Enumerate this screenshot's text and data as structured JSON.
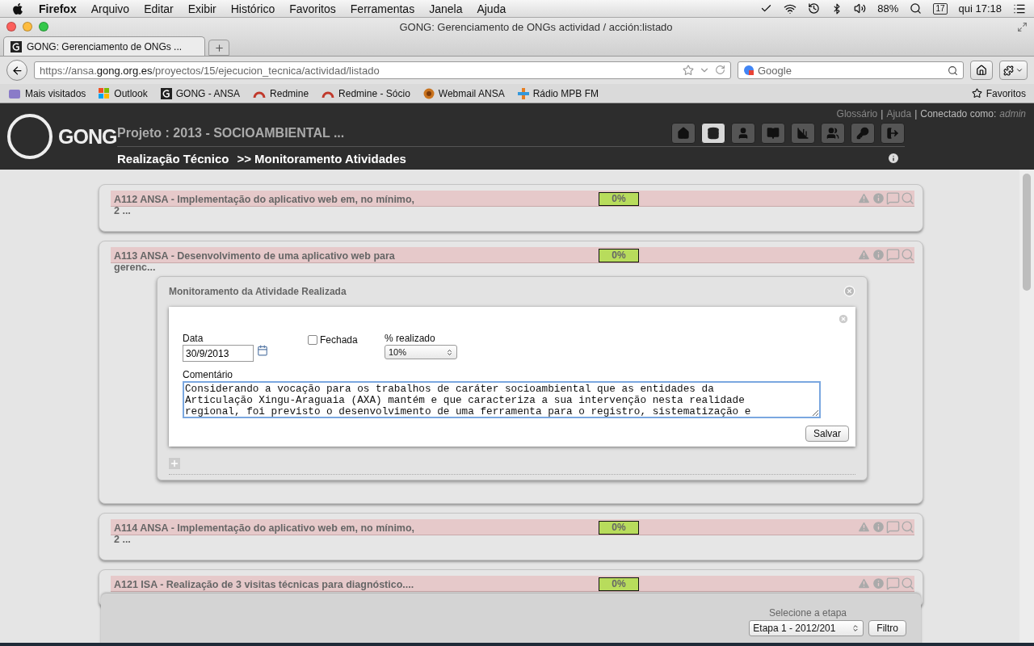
{
  "browser": {
    "menubar": {
      "app": "Firefox",
      "menus": [
        "Arquivo",
        "Editar",
        "Exibir",
        "Histórico",
        "Favoritos",
        "Ferramentas",
        "Janela",
        "Ajuda"
      ],
      "battery": "88%",
      "date_badge": "17",
      "clock": "qui 17:18"
    },
    "window_title": "GONG: Gerenciamento de ONGs actividad / acción:listado",
    "tabs": [
      {
        "title": "GONG: Gerenciamento de ONGs ...",
        "selected": true
      }
    ],
    "url": "https://ansa.**gong.org.es**/proyectos/15/ejecucion_tecnica/actividad/listado",
    "search": {
      "placeholder": "Google"
    },
    "bookmarks": [
      {
        "label": "Mais visitados",
        "kind": "folder"
      },
      {
        "label": "Outlook",
        "kind": "tiles"
      },
      {
        "label": "GONG - ANSA",
        "kind": "letter"
      },
      {
        "label": "Redmine",
        "kind": "arc"
      },
      {
        "label": "Redmine - Sócio",
        "kind": "arc"
      },
      {
        "label": "Webmail ANSA",
        "kind": "globe"
      },
      {
        "label": "Rádio MPB FM",
        "kind": "cross"
      }
    ],
    "favorites": "Favoritos"
  },
  "header": {
    "logo": "GONG",
    "project": "Projeto : 2013 - SOCIOAMBIENTAL ...",
    "links": [
      "Glossário",
      "Ajuda"
    ],
    "separator": "|",
    "connected_label": "Conectado como:",
    "user": "admin",
    "breadcrumb": [
      "Realização Técnico",
      ">> Monitoramento Atividades"
    ],
    "nav": [
      {
        "kind": "home",
        "selected": false
      },
      {
        "kind": "database",
        "selected": true
      },
      {
        "kind": "user",
        "selected": false
      },
      {
        "kind": "book",
        "selected": false
      },
      {
        "kind": "chart",
        "selected": false
      },
      {
        "kind": "users",
        "selected": false
      },
      {
        "kind": "key",
        "selected": false
      },
      {
        "kind": "exit",
        "selected": false
      }
    ]
  },
  "activities": [
    {
      "title": "A112 ANSA - Implementação do aplicativo web em, no mínimo, 2 ...",
      "progress": "0%",
      "expanded": false
    },
    {
      "title": "A113 ANSA - Desenvolvimento de uma aplicativo web para gerenc...",
      "progress": "0%",
      "expanded": true
    },
    {
      "title": "A114 ANSA - Implementação do aplicativo web em, no mínimo, 2 ...",
      "progress": "0%",
      "expanded": false
    },
    {
      "title": "A121 ISA - Realização de 3 visitas técnicas para diagnóstico....",
      "progress": "0%",
      "expanded": false
    }
  ],
  "monitor": {
    "title": "Monitoramento da Atividade Realizada",
    "date_label": "Data",
    "date_value": "30/9/2013",
    "closed": {
      "label": "Fechada",
      "checked": false
    },
    "percent_label": "% realizado",
    "percent_value": "10%",
    "comment_label": "Comentário",
    "comment_value": "Considerando a vocação para os trabalhos de caráter socioambiental que as entidades da Articulação Xingu-Araguaia (AXA) mantém e que caracteriza a sua intervenção nesta realidade regional, foi previsto o desenvolvimento de uma ferramenta para o registro, sistematização e",
    "save": "Salvar"
  },
  "footer": {
    "label": "Selecione a etapa",
    "stage": "Etapa 1 - 2012/201",
    "filter": "Filtro"
  }
}
